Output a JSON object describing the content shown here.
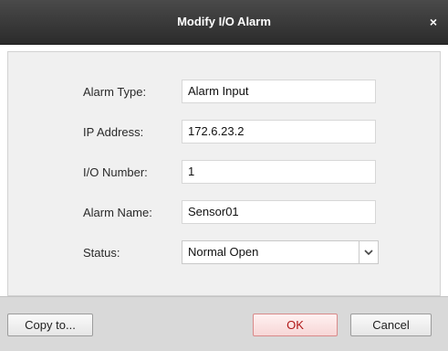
{
  "dialog": {
    "title": "Modify I/O Alarm",
    "close_symbol": "×"
  },
  "form": {
    "alarm_type": {
      "label": "Alarm Type:",
      "value": "Alarm Input"
    },
    "ip_address": {
      "label": "IP Address:",
      "value": "172.6.23.2"
    },
    "io_number": {
      "label": "I/O Number:",
      "value": "1"
    },
    "alarm_name": {
      "label": "Alarm Name:",
      "value": "Sensor01"
    },
    "status": {
      "label": "Status:",
      "selected": "Normal Open"
    }
  },
  "buttons": {
    "copy_to": "Copy to...",
    "ok": "OK",
    "cancel": "Cancel"
  },
  "icons": {
    "close": "close-icon",
    "dropdown": "chevron-down-icon"
  }
}
